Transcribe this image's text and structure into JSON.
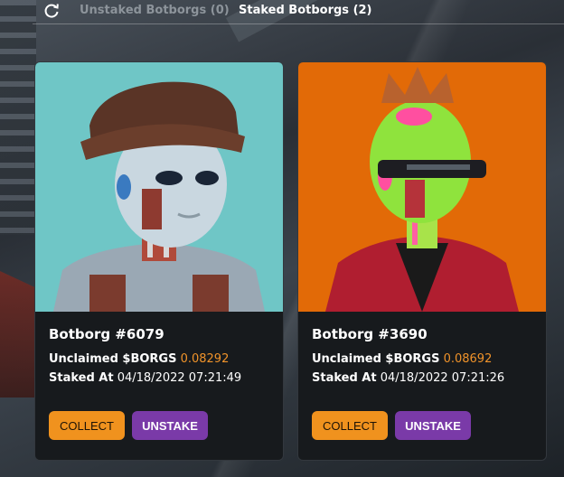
{
  "tabs": {
    "refresh_icon": "refresh-icon",
    "unstaked_label": "Unstaked Botborgs (0)",
    "staked_label": "Staked Botborgs (2)"
  },
  "colors": {
    "accent_orange": "#f0921e",
    "unstake_purple": "#7a3aa8",
    "card_bg": "#171a1d"
  },
  "cards": [
    {
      "name": "Botborg #6079",
      "unclaimed_label": "Unclaimed $BORGS",
      "unclaimed_value": "0.08292",
      "staked_label": "Staked At",
      "staked_value": "04/18/2022 07:21:49",
      "collect_label": "COLLECT",
      "unstake_label": "UNSTAKE",
      "art_background": "#6fc6c6"
    },
    {
      "name": "Botborg #3690",
      "unclaimed_label": "Unclaimed $BORGS",
      "unclaimed_value": "0.08692",
      "staked_label": "Staked At",
      "staked_value": "04/18/2022 07:21:26",
      "collect_label": "COLLECT",
      "unstake_label": "UNSTAKE",
      "art_background": "#e26a07"
    }
  ]
}
